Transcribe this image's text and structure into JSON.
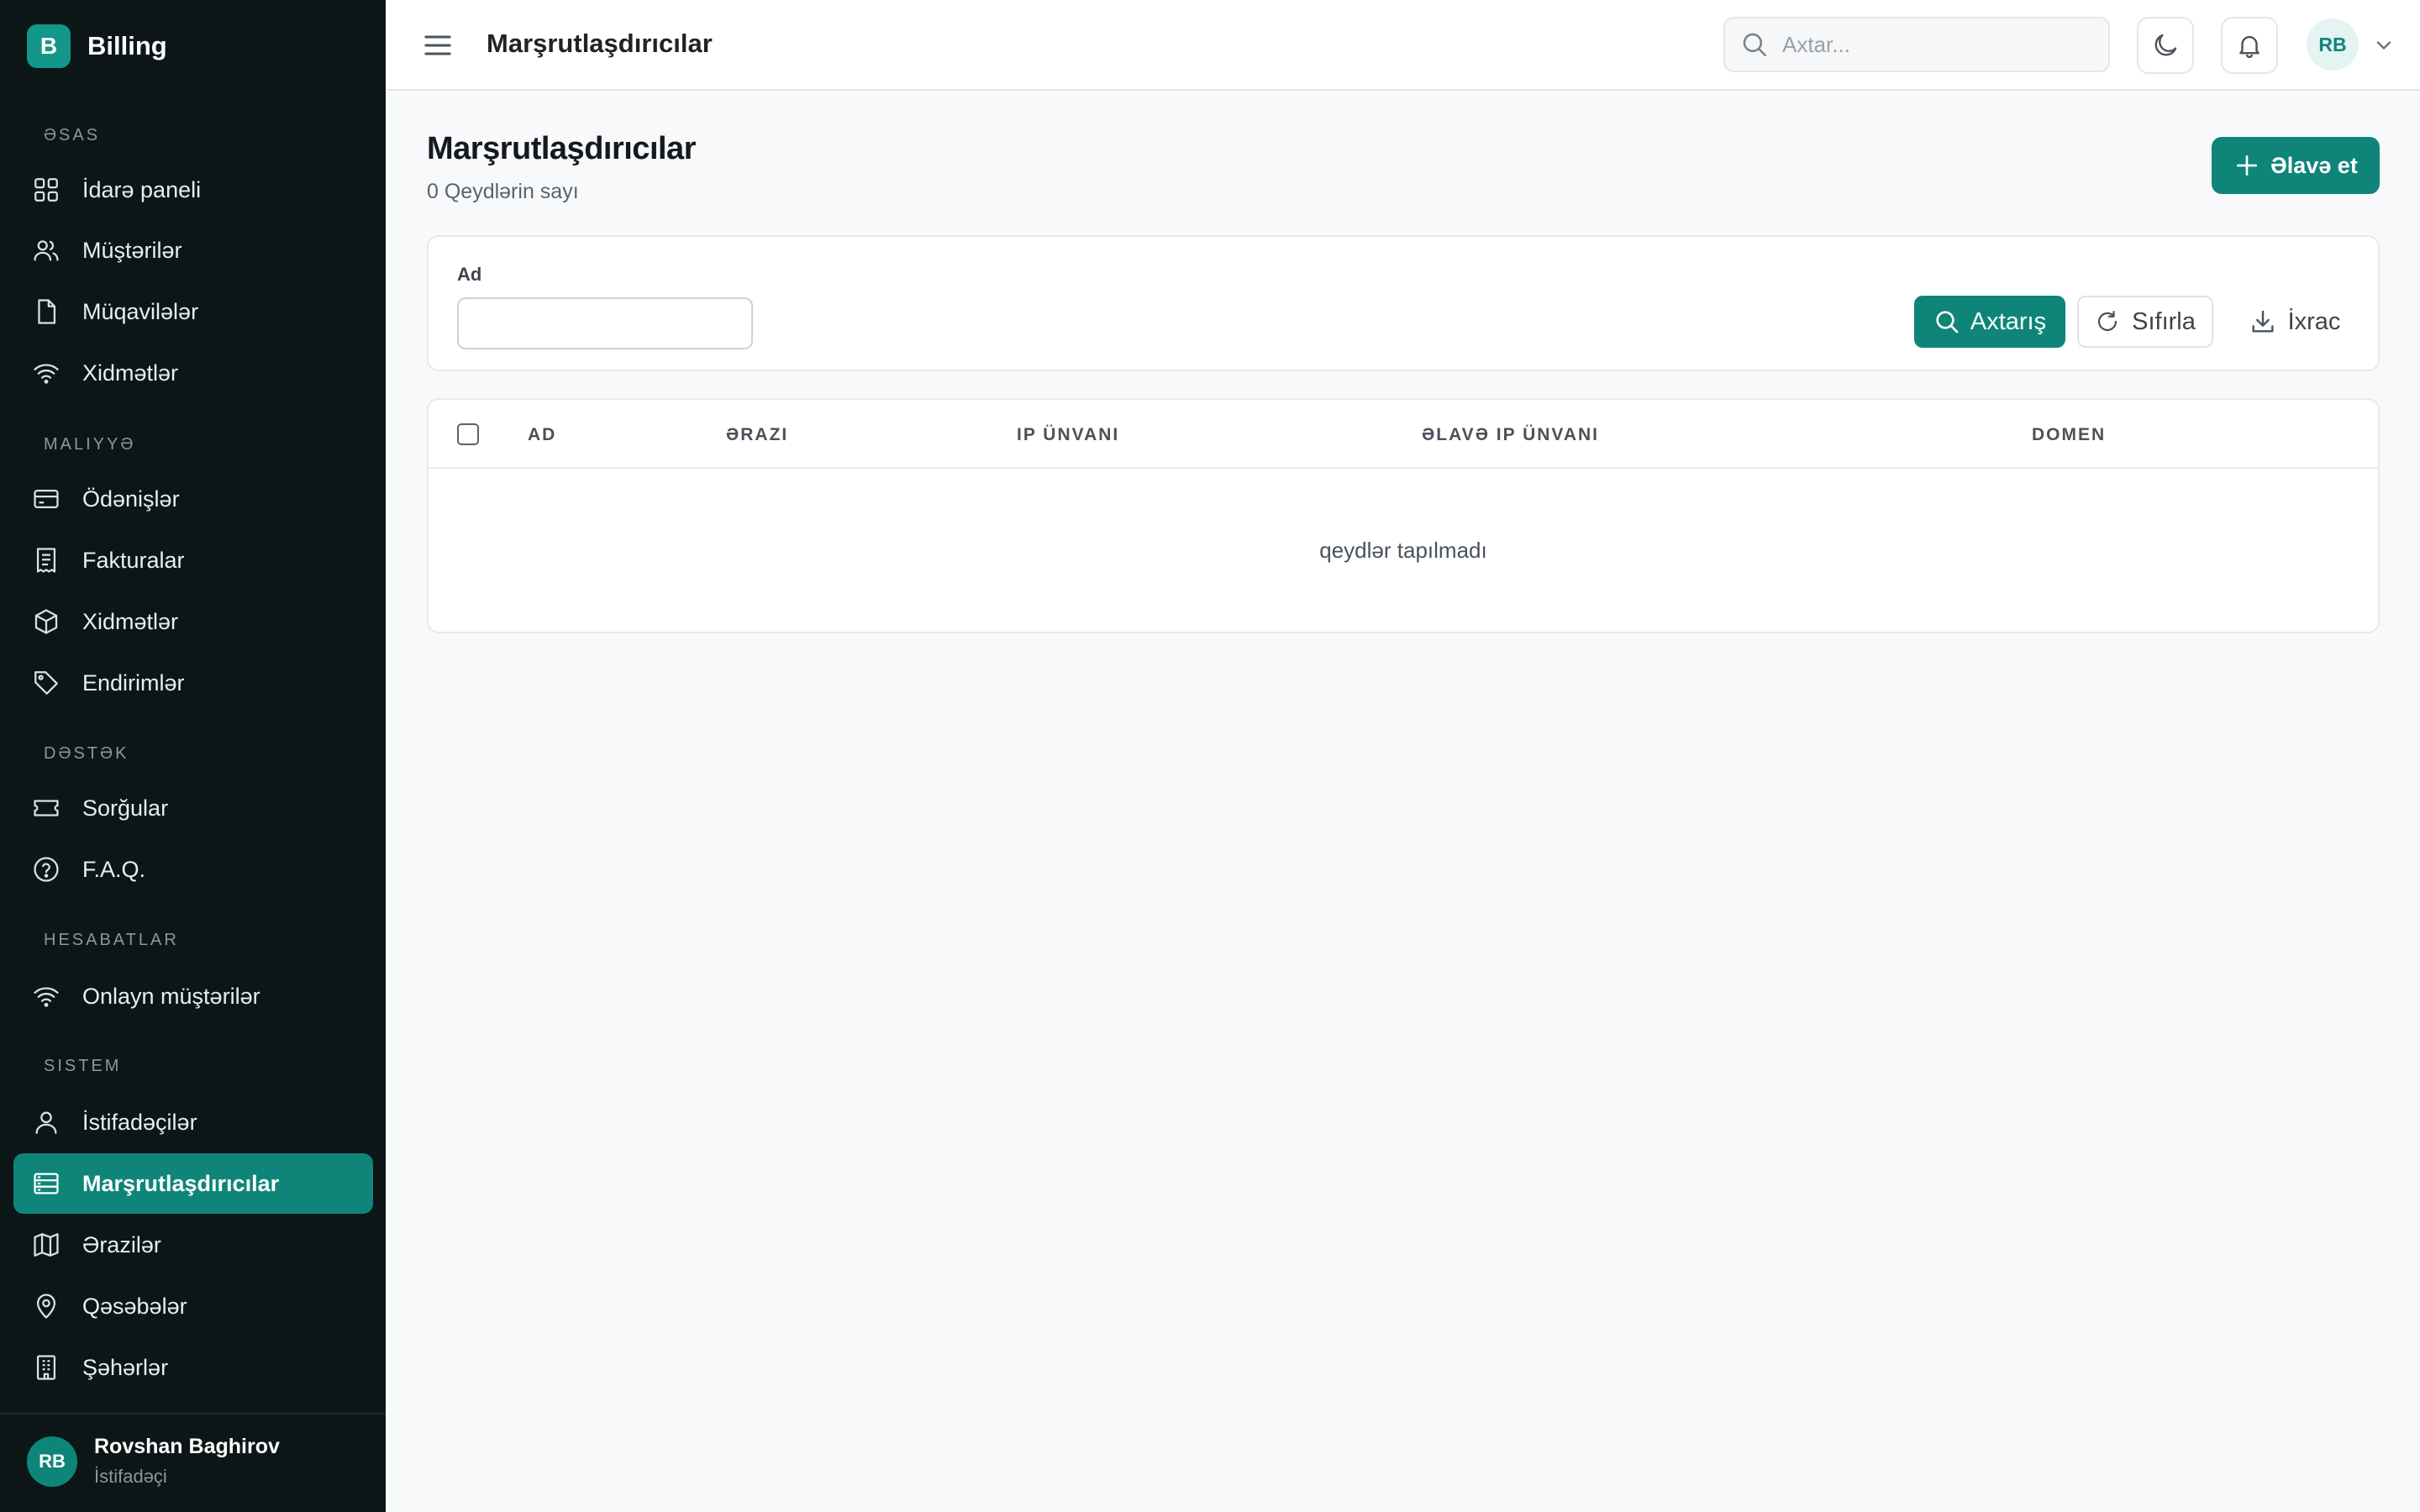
{
  "app": {
    "logo_letter": "B",
    "name": "Billing"
  },
  "sidebar": {
    "sections": [
      {
        "title": "Əsas",
        "items": [
          {
            "label": "İdarə paneli",
            "icon": "grid-icon"
          },
          {
            "label": "Müştərilər",
            "icon": "users-icon"
          },
          {
            "label": "Müqavilələr",
            "icon": "file-icon"
          },
          {
            "label": "Xidmətlər",
            "icon": "wifi-icon"
          }
        ]
      },
      {
        "title": "Maliyyə",
        "items": [
          {
            "label": "Ödənişlər",
            "icon": "credit-card-icon"
          },
          {
            "label": "Fakturalar",
            "icon": "receipt-icon"
          },
          {
            "label": "Xidmətlər",
            "icon": "box-icon"
          },
          {
            "label": "Endirimlər",
            "icon": "tag-icon"
          }
        ]
      },
      {
        "title": "Dəstək",
        "items": [
          {
            "label": "Sorğular",
            "icon": "ticket-icon"
          },
          {
            "label": "F.A.Q.",
            "icon": "help-circle-icon"
          }
        ]
      },
      {
        "title": "Hesabatlar",
        "items": [
          {
            "label": "Onlayn müştərilər",
            "icon": "wifi-icon"
          }
        ]
      },
      {
        "title": "Sistem",
        "items": [
          {
            "label": "İstifadəçilər",
            "icon": "user-icon"
          },
          {
            "label": "Marşrutlaşdırıcılar",
            "icon": "server-icon",
            "active": true
          },
          {
            "label": "Ərazilər",
            "icon": "map-icon"
          },
          {
            "label": "Qəsəbələr",
            "icon": "map-pin-icon"
          },
          {
            "label": "Şəhərlər",
            "icon": "building-icon"
          }
        ]
      }
    ],
    "user": {
      "initials": "RB",
      "name": "Rovshan Baghirov",
      "role": "İstifadəçi"
    }
  },
  "header": {
    "title": "Marşrutlaşdırıcılar",
    "search_placeholder": "Axtar...",
    "avatar_initials": "RB"
  },
  "page": {
    "title": "Marşrutlaşdırıcılar",
    "subtitle": "0 Qeydlərin sayı",
    "add_label": "Əlavə et"
  },
  "filters": {
    "name_label": "Ad",
    "name_value": "",
    "search_label": "Axtarış",
    "reset_label": "Sıfırla",
    "export_label": "İxrac"
  },
  "table": {
    "columns": [
      "Ad",
      "Ərazi",
      "IP ünvanı",
      "Əlavə IP ünvanı",
      "Domen"
    ],
    "empty_text": "qeydlər tapılmadı"
  },
  "colors": {
    "accent": "#0f857a",
    "sidebar_bg": "#0c1617",
    "page_bg": "#f8f9fa"
  }
}
